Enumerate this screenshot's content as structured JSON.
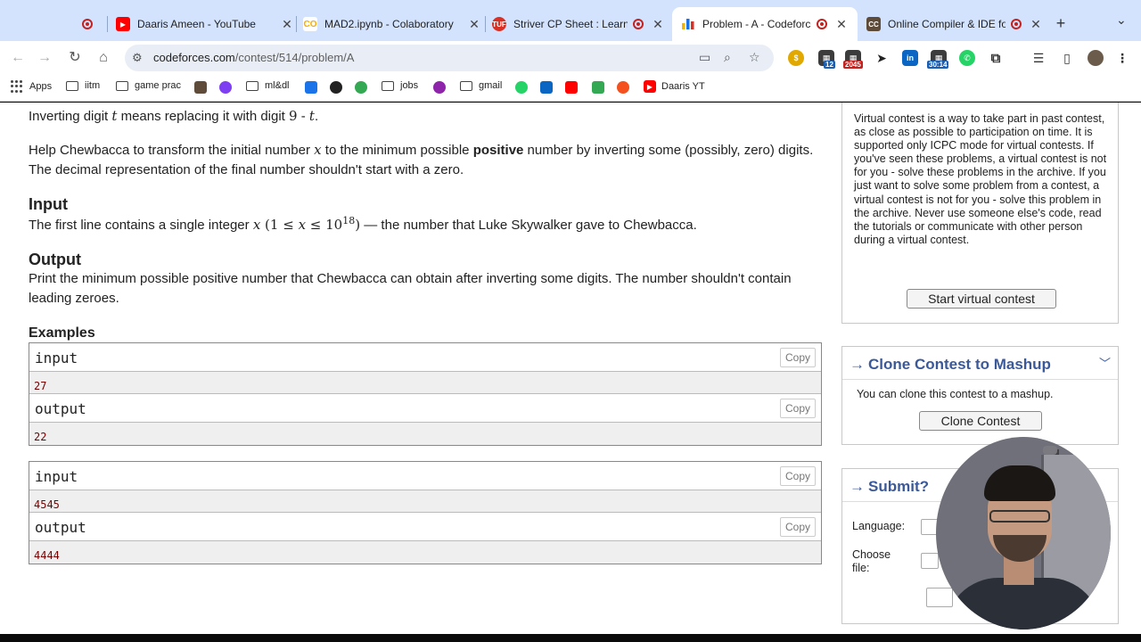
{
  "browser": {
    "tabs": [
      {
        "title": "",
        "icon": "record-icon",
        "color": "#c5221f"
      },
      {
        "title": "Daaris Ameen - YouTube",
        "icon": "youtube-icon",
        "color": "#ff0000"
      },
      {
        "title": "MAD2.ipynb - Colaboratory",
        "icon": "colab-icon",
        "color": "#f9ab00"
      },
      {
        "title": "Striver CP Sheet : Learn C",
        "icon": "tuf-icon",
        "color": "#d93025"
      },
      {
        "title": "Problem - A - Codeforces",
        "icon": "codeforces-icon",
        "color": "#1a73e8",
        "active": true
      },
      {
        "title": "Online Compiler & IDE for",
        "icon": "cc-icon",
        "color": "#5f4b3a"
      }
    ],
    "url_host": "codeforces.com",
    "url_path": "/contest/514/problem/A",
    "extension_badges": [
      "12",
      "2045",
      "30:14"
    ],
    "bookmarks": [
      {
        "label": "Apps",
        "icon": "apps-grid-icon"
      },
      {
        "label": "iitm",
        "icon": "folder-icon"
      },
      {
        "label": "game prac",
        "icon": "folder-icon"
      },
      {
        "label": "ml&dl",
        "icon": "folder-icon"
      },
      {
        "label": "jobs",
        "icon": "folder-icon"
      },
      {
        "label": "gmail",
        "icon": "folder-icon"
      },
      {
        "label": "Daaris YT",
        "icon": "youtube-icon"
      }
    ]
  },
  "problem": {
    "invert_sentence_pre": "Inverting digit ",
    "var_t": "t",
    "invert_sentence_mid": " means replacing it with digit ",
    "nine": "9",
    "minus": " - ",
    "invert_end": ".",
    "help_pre": "Help Chewbacca to transform the initial number ",
    "var_x": "x",
    "help_mid": " to the minimum possible ",
    "help_bold": "positive",
    "help_post": " number by inverting some (possibly, zero) digits. The decimal representation of the final number shouldn't start with a zero.",
    "input_title": "Input",
    "input_pre": "The first line contains a single integer ",
    "input_constraint_open": " (1 ≤ ",
    "input_constraint_mid": " ≤ 10",
    "input_exp": "18",
    "input_constraint_close": ")",
    "input_post": " — the number that Luke Skywalker gave to Chewbacca.",
    "output_title": "Output",
    "output_text": "Print the minimum possible positive number that Chewbacca can obtain after inverting some digits. The number shouldn't contain leading zeroes.",
    "examples_title": "Examples",
    "examples": [
      {
        "input_label": "input",
        "input_value": "27",
        "output_label": "output",
        "output_value": "22"
      },
      {
        "input_label": "input",
        "input_value": "4545",
        "output_label": "output",
        "output_value": "4444"
      }
    ],
    "copy_label": "Copy"
  },
  "sidebar": {
    "virtual_text": "Virtual contest is a way to take part in past contest, as close as possible to participation on time. It is supported only ICPC mode for virtual contests. If you've seen these problems, a virtual contest is not for you - solve these problems in the archive. If you just want to solve some problem from a contest, a virtual contest is not for you - solve this problem in the archive. Never use someone else's code, read the tutorials or communicate with other person during a virtual contest.",
    "virtual_button": "Start virtual contest",
    "clone_title": "Clone Contest to Mashup",
    "clone_text": "You can clone this contest to a mashup.",
    "clone_button": "Clone Contest",
    "submit_title": "Submit?",
    "language_label": "Language:",
    "file_label": "Choose file:",
    "arrow": "→"
  },
  "colors": {
    "tabbar": "#d3e3fd",
    "link_blue": "#3b5998",
    "sample_value": "#770000"
  }
}
